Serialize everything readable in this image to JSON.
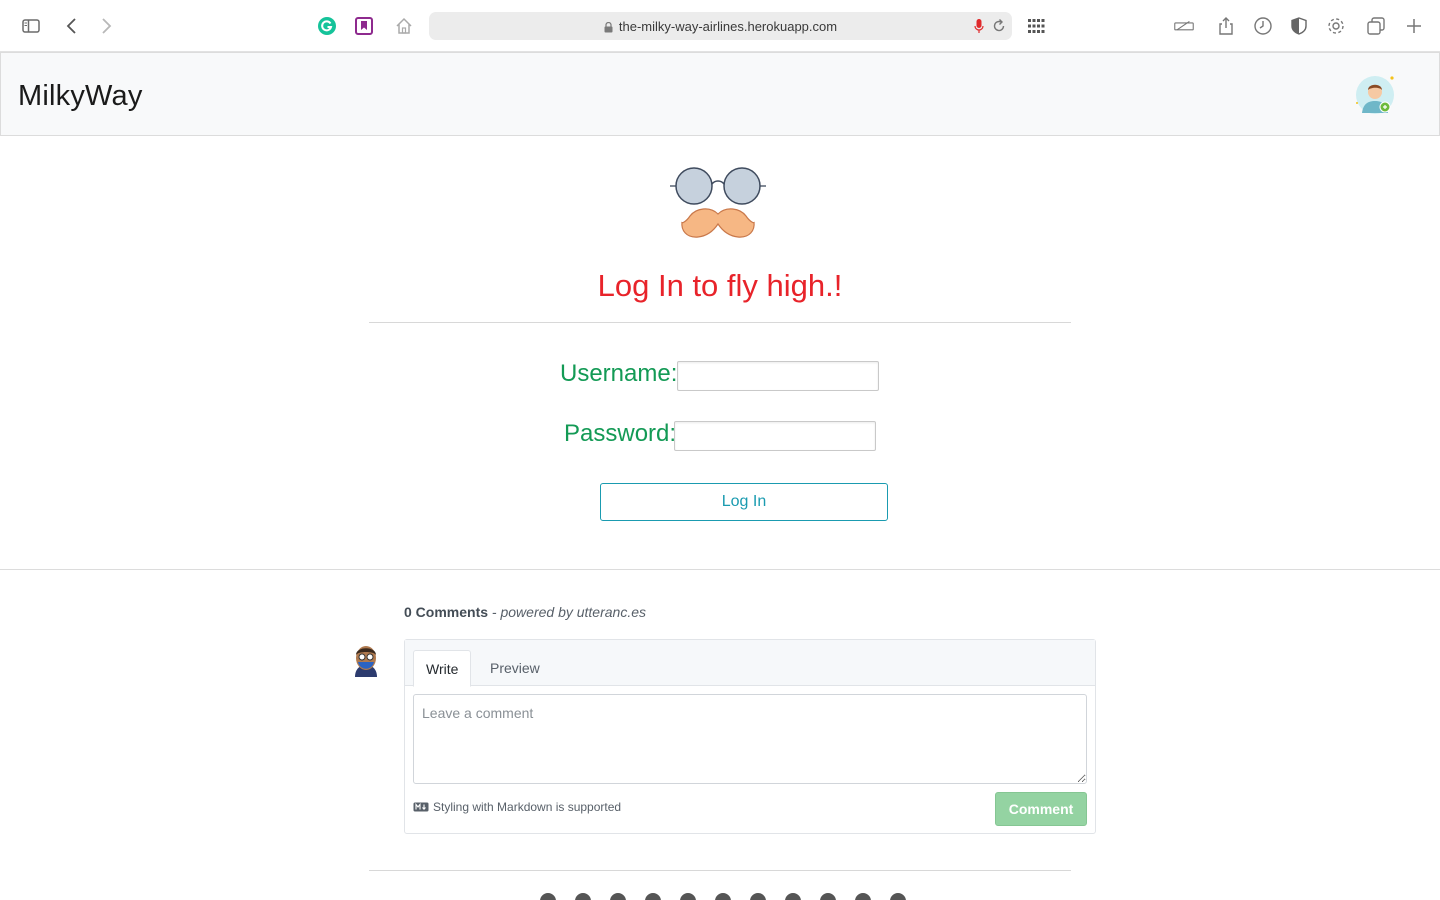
{
  "browser": {
    "url": "the-milky-way-airlines.herokuapp.com"
  },
  "header": {
    "brand": "MilkyWay"
  },
  "login": {
    "title": "Log In to fly high.!",
    "username_label": "Username:",
    "password_label": "Password:",
    "username_value": "",
    "password_value": "",
    "submit_label": "Log In",
    "title_color": "#e8232a",
    "label_color": "#139a55",
    "button_color": "#1a9bb0"
  },
  "comments": {
    "count_label": "0 Comments",
    "powered_by": "- powered by utteranc.es",
    "tabs": [
      "Write",
      "Preview"
    ],
    "active_tab": "Write",
    "placeholder": "Leave a comment",
    "markdown_note": "Styling with Markdown is supported",
    "submit_label": "Comment"
  },
  "icons": {
    "toolbar_left": [
      "sidebar-icon",
      "back-icon",
      "forward-icon"
    ],
    "extensions": [
      "grammarly-icon",
      "bookmark-extension-icon",
      "home-icon"
    ],
    "toolbar_right": [
      "grid-icon",
      "reader-icon",
      "share-icon",
      "history-icon",
      "shield-icon",
      "settings-icon",
      "tabs-icon",
      "new-tab-icon"
    ]
  }
}
